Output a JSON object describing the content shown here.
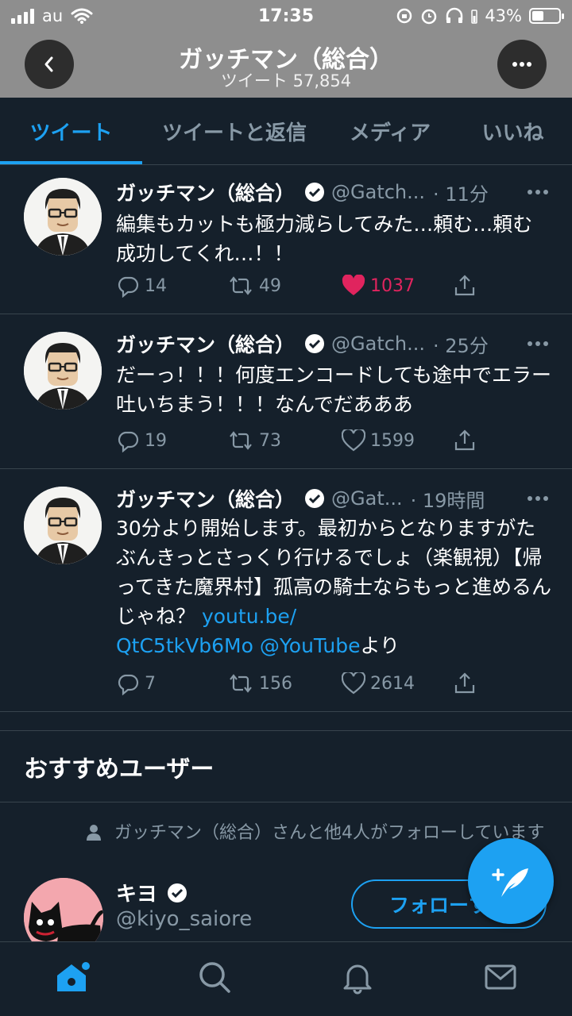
{
  "status_bar": {
    "carrier": "au",
    "time": "17:35",
    "battery": "43%",
    "battery_level": 0.43
  },
  "header": {
    "title": "ガッチマン（総合）",
    "subtitle": "ツイート 57,854",
    "back_icon": "chevron-left-icon",
    "more_icon": "more-horizontal-icon"
  },
  "tabs": [
    {
      "label": "ツイート",
      "active": true
    },
    {
      "label": "ツイートと返信",
      "active": false
    },
    {
      "label": "メディア",
      "active": false
    },
    {
      "label": "いいね",
      "active": false
    }
  ],
  "tweets": [
    {
      "name": "ガッチマン（総合）",
      "handle": "@Gatch...",
      "time": "· 11分",
      "text": "編集もカットも極力減らしてみた…頼む…頼む成功してくれ…！！",
      "replies": "14",
      "retweets": "49",
      "likes": "1037",
      "liked": true
    },
    {
      "name": "ガッチマン（総合）",
      "handle": "@Gatch...",
      "time": "· 25分",
      "text": "だーっ！！！何度エンコードしても途中でエラー吐いちまう！！！なんでだあああ",
      "replies": "19",
      "retweets": "73",
      "likes": "1599",
      "liked": false
    },
    {
      "name": "ガッチマン（総合）",
      "handle": "@Gat...",
      "time": "· 19時間",
      "text": "30分より開始します。最初からとなりますがたぶんきっとさっくり行けるでしょ（楽観視）【帰ってきた魔界村】孤高の騎士ならもっと進めるんじゃね？ ",
      "link": "youtu.be/\nQtC5tkVb6Mo",
      "mention": "@YouTube",
      "suffix": "より",
      "replies": "7",
      "retweets": "156",
      "likes": "2614",
      "liked": false
    }
  ],
  "recommendations": {
    "title": "おすすめユーザー",
    "social_context": "ガッチマン（総合）さんと他4人がフォローしています",
    "user": {
      "name": "キヨ",
      "handle": "@kiyo_saiore",
      "follow_label": "フォローする"
    }
  },
  "nav": [
    "home-icon",
    "search-icon",
    "notifications-icon",
    "messages-icon"
  ],
  "colors": {
    "background": "#15202b",
    "accent": "#1da1f2",
    "like": "#e0245e",
    "secondary_text": "#8899a6"
  }
}
